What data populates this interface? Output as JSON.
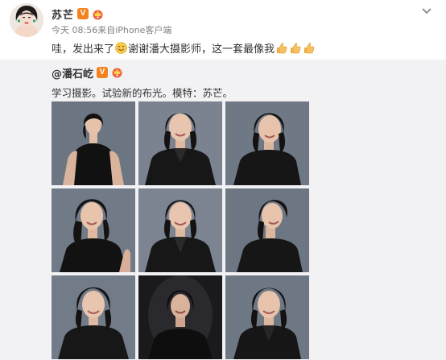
{
  "post": {
    "author_name": "苏芒",
    "timestamp": "今天 08:56",
    "source": "来自iPhone客户端",
    "text_part1": "哇，发出来了",
    "text_part2": "谢谢潘大摄影师，这一套最像我"
  },
  "repost": {
    "author_name": "@潘石屹",
    "text": "学习摄影。试验新的布光。模特：苏芒。"
  },
  "icons": {
    "verified": "verified-v-badge-icon",
    "member": "member-crown-icon",
    "expand": "chevron-down-icon",
    "smile_emoji": "smile-emoji-icon",
    "thumbs_up_emoji": "thumbs-up-emoji-icon"
  },
  "badge": {
    "verified_letter": "V"
  },
  "colors": {
    "verified_orange": "#f5821f",
    "repost_background": "#f2f2f5",
    "meta_gray": "#808080",
    "text": "#333333"
  },
  "photos": [
    {
      "name": "photo-1",
      "backdrop": "#6c7683",
      "outfit": "black dress"
    },
    {
      "name": "photo-2",
      "backdrop": "#7a838f",
      "outfit": "black blazer"
    },
    {
      "name": "photo-3",
      "backdrop": "#6f7986",
      "outfit": "black blazer"
    },
    {
      "name": "photo-4",
      "backdrop": "#717b88",
      "outfit": "black dress"
    },
    {
      "name": "photo-5",
      "backdrop": "#7b8490",
      "outfit": "black blazer"
    },
    {
      "name": "photo-6",
      "backdrop": "#6d7784",
      "outfit": "black blazer"
    },
    {
      "name": "photo-7",
      "backdrop": "#727c89",
      "outfit": "black blazer"
    },
    {
      "name": "photo-8",
      "backdrop": "#1a1a1c",
      "outfit": "black blazer"
    },
    {
      "name": "photo-9",
      "backdrop": "#6e7885",
      "outfit": "black blazer"
    }
  ]
}
